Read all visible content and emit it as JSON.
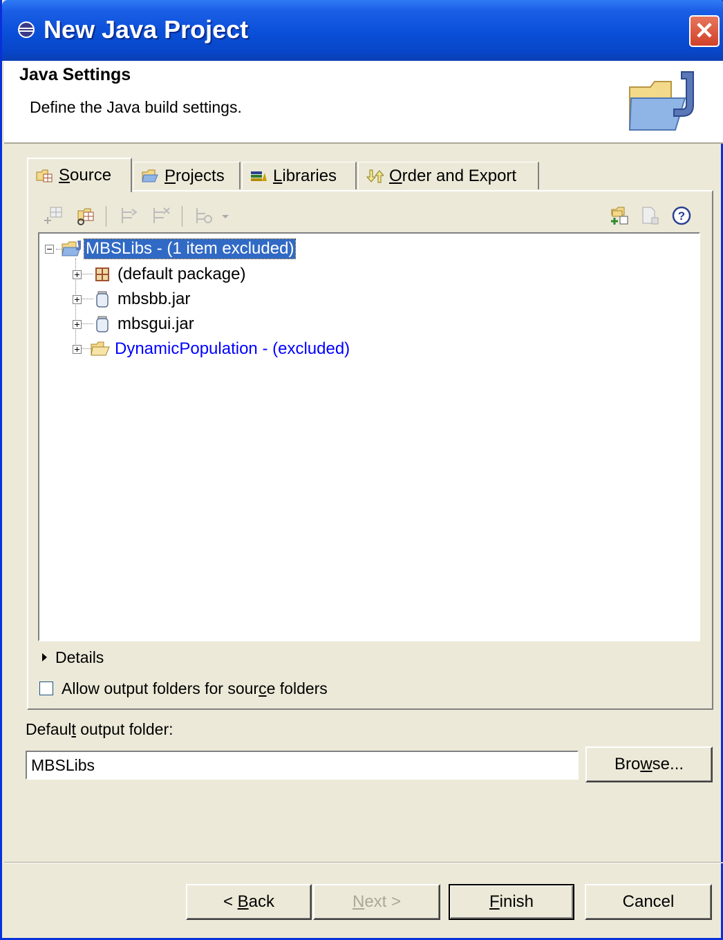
{
  "window": {
    "title": "New Java Project",
    "close_label": "✕"
  },
  "banner": {
    "title": "Java Settings",
    "description": "Define the Java build settings."
  },
  "tabs": [
    {
      "pre": "",
      "mnemonic": "S",
      "post": "ource",
      "icon": "source-folder-icon",
      "selected": true
    },
    {
      "pre": "",
      "mnemonic": "P",
      "post": "rojects",
      "icon": "projects-icon",
      "selected": false
    },
    {
      "pre": "",
      "mnemonic": "L",
      "post": "ibraries",
      "icon": "libraries-icon",
      "selected": false
    },
    {
      "pre": "",
      "mnemonic": "O",
      "post": "rder and Export",
      "icon": "order-export-icon",
      "selected": false
    }
  ],
  "toolbar": {
    "left_icons": [
      "add-source-folder-icon",
      "link-source-icon",
      "include-icon",
      "exclude-icon",
      "configure-icon",
      "dropdown-arrow-icon"
    ],
    "right_icons": [
      "new-folder-icon",
      "edit-icon",
      "help-icon"
    ]
  },
  "tree": {
    "root": {
      "label": "MBSLibs - (1 item excluded)",
      "expanded": true,
      "icon": "project-folder-icon"
    },
    "children": [
      {
        "label": "(default package)",
        "icon": "package-icon",
        "excluded": false
      },
      {
        "label": "mbsbb.jar",
        "icon": "jar-icon",
        "excluded": false
      },
      {
        "label": "mbsgui.jar",
        "icon": "jar-icon",
        "excluded": false
      },
      {
        "label": "DynamicPopulation - (excluded)",
        "icon": "folder-icon",
        "excluded": true
      }
    ]
  },
  "details": {
    "label": "Details"
  },
  "allow_output": {
    "pre": "Allow output folders for sour",
    "mnemonic": "c",
    "post": "e folders",
    "checked": false
  },
  "output_folder": {
    "pre": "Defaul",
    "mnemonic": "t",
    "post": " output folder:",
    "value": "MBSLibs"
  },
  "buttons": {
    "browse": {
      "pre": "Bro",
      "mnemonic": "w",
      "post": "se..."
    },
    "back": {
      "pre": "< ",
      "mnemonic": "B",
      "post": "ack"
    },
    "next": {
      "pre": "",
      "mnemonic": "N",
      "post": "ext >"
    },
    "finish": {
      "pre": "",
      "mnemonic": "F",
      "post": "inish"
    },
    "cancel": {
      "label": "Cancel"
    }
  },
  "colors": {
    "titlebar": "#0a4fd8",
    "selection": "#316ac5",
    "excluded_text": "#0000ff",
    "dialog_bg": "#ece9d8"
  }
}
